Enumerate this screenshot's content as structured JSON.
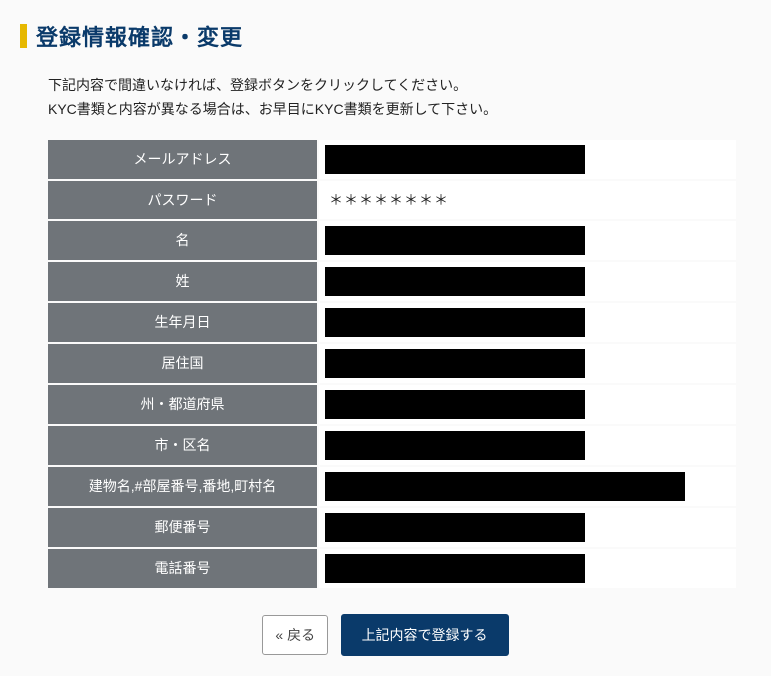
{
  "title": "登録情報確認・変更",
  "instructions": {
    "line1": "下記内容で間違いなければ、登録ボタンをクリックしてください。",
    "line2": "KYC書類と内容が異なる場合は、お早目にKYC書類を更新して下さい。"
  },
  "fields": {
    "email": {
      "label": "メールアドレス"
    },
    "password": {
      "label": "パスワード",
      "value": "＊＊＊＊＊＊＊＊"
    },
    "first_name": {
      "label": "名"
    },
    "last_name": {
      "label": "姓"
    },
    "birthdate": {
      "label": "生年月日"
    },
    "country": {
      "label": "居住国"
    },
    "state": {
      "label": "州・都道府県"
    },
    "city": {
      "label": "市・区名"
    },
    "building": {
      "label": "建物名,#部屋番号,番地,町村名"
    },
    "postal": {
      "label": "郵便番号"
    },
    "phone": {
      "label": "電話番号"
    }
  },
  "buttons": {
    "back": "« 戻る",
    "submit": "上記内容で登録する"
  }
}
